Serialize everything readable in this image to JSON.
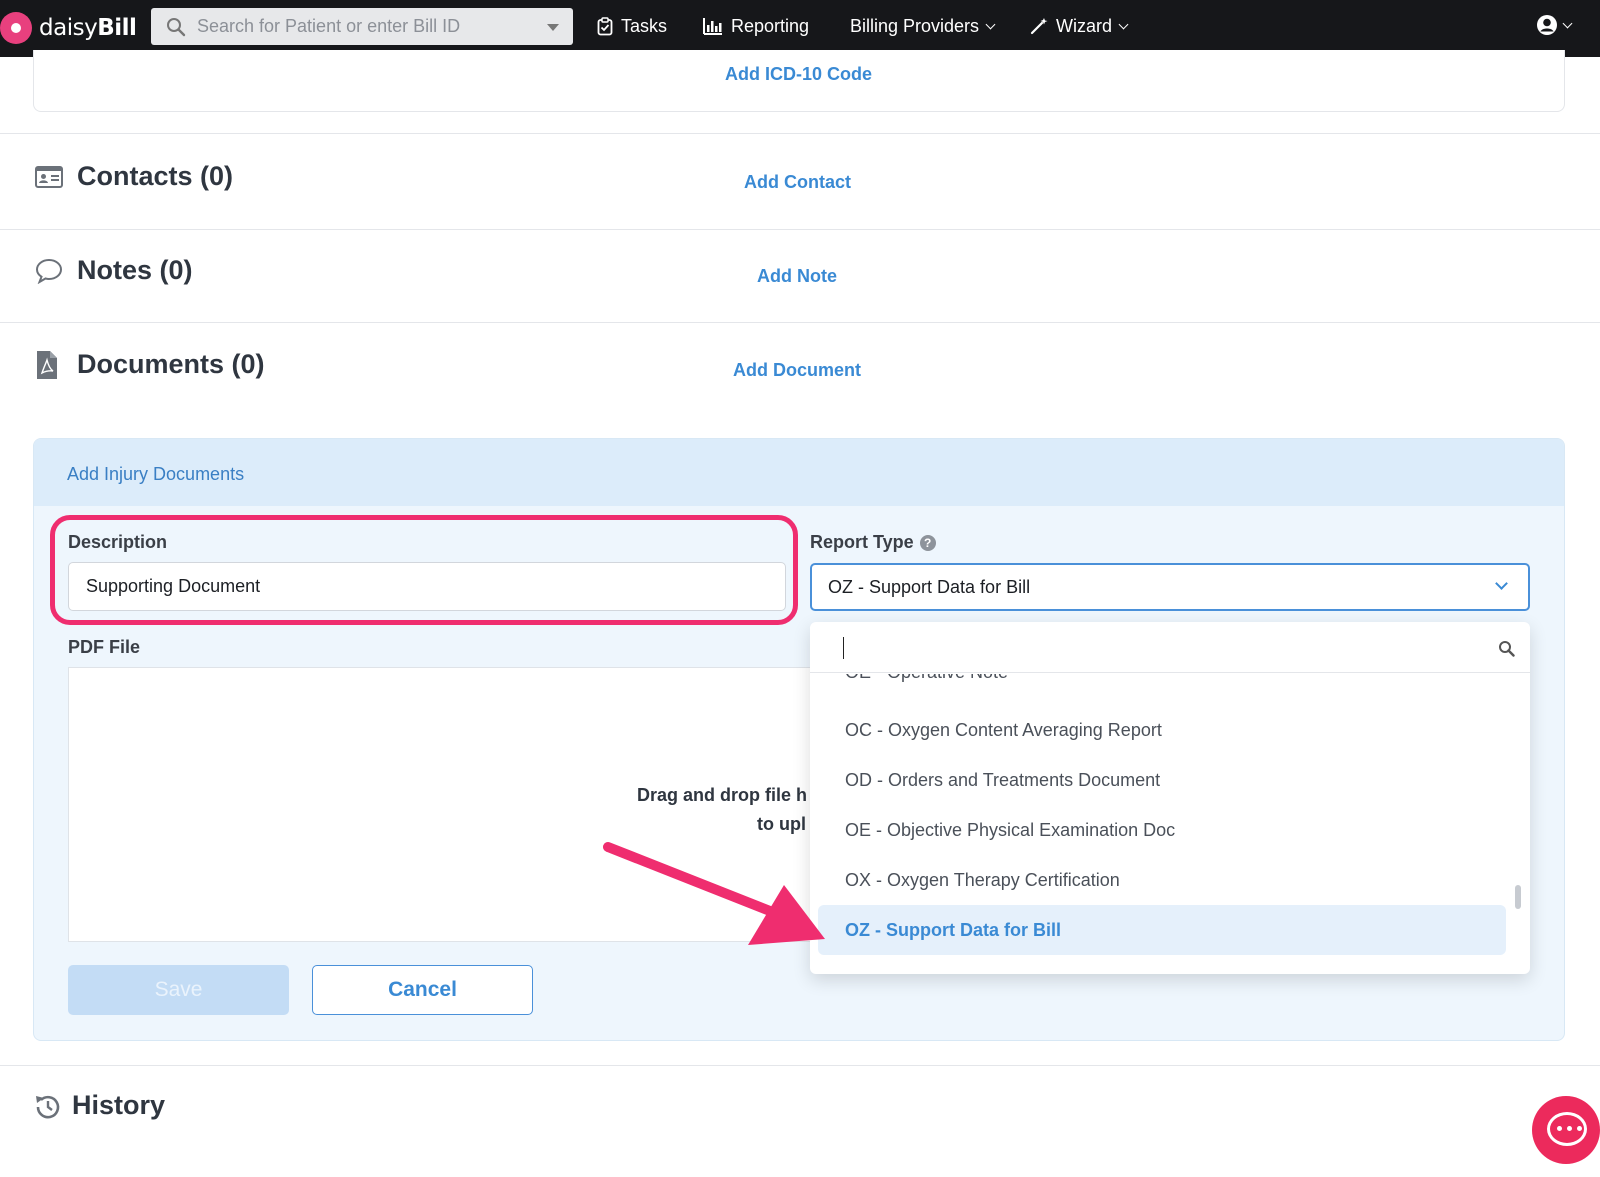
{
  "app": {
    "logo_regular": "daisy",
    "logo_bold": "Bill"
  },
  "nav": {
    "search_placeholder": "Search for Patient or enter Bill ID",
    "items": [
      {
        "label": "Tasks",
        "icon": "clipboard-check-icon"
      },
      {
        "label": "Reporting",
        "icon": "bar-chart-icon"
      },
      {
        "label": "Billing Providers",
        "icon": null
      },
      {
        "label": "Wizard",
        "icon": "magic-wand-icon"
      }
    ],
    "user_icon": "user-circle-icon"
  },
  "icd": {
    "add_label": "Add ICD-10 Code"
  },
  "contacts": {
    "title": "Contacts (0)",
    "add_label": "Add Contact",
    "icon": "id-card-icon"
  },
  "notes": {
    "title": "Notes (0)",
    "add_label": "Add Note",
    "icon": "speech-bubble-icon"
  },
  "documents": {
    "title": "Documents (0)",
    "add_label": "Add Document",
    "icon": "pdf-file-icon",
    "panel": {
      "header": "Add Injury Documents",
      "description_label": "Description",
      "description_value": "Supporting Document",
      "report_type_label": "Report Type",
      "report_type_value": "OZ - Support Data for Bill",
      "pdf_label": "PDF File",
      "drop_line1": "Drag and drop file h",
      "drop_line2": "to upl",
      "save_label": "Save",
      "cancel_label": "Cancel"
    },
    "dropdown": {
      "search_value": "",
      "partial_item": "OE - Operative Note",
      "items": [
        "OC - Oxygen Content Averaging Report",
        "OD - Orders and Treatments Document",
        "OE - Objective Physical Examination Doc",
        "OX - Oxygen Therapy Certification",
        "OZ - Support Data for Bill"
      ],
      "selected": "OZ - Support Data for Bill"
    }
  },
  "history": {
    "title": "History",
    "icon": "history-clock-icon"
  },
  "colors": {
    "accent": "#3a8ad4",
    "highlight": "#ef2d6f",
    "nav_bg": "#16171a",
    "brand": "#e8407e"
  }
}
